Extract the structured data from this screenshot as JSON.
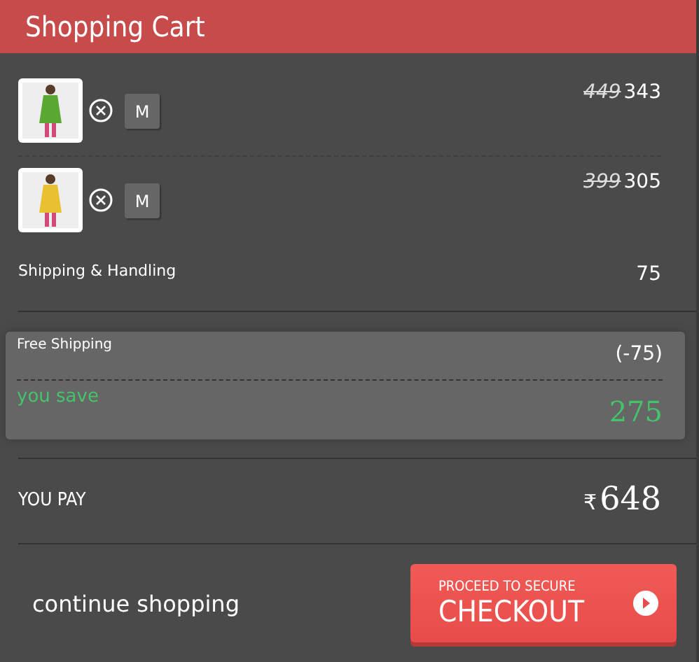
{
  "header": {
    "title": "Shopping Cart"
  },
  "items": [
    {
      "kind": "picture",
      "size": "M",
      "old_price": "449",
      "price": "343"
    },
    {
      "kind": "picture",
      "size": "M",
      "old_price": "399",
      "price": "305"
    }
  ],
  "shipping": {
    "label": "Shipping & Handling",
    "amount": "75"
  },
  "savings": {
    "free_shipping_label": "Free Shipping",
    "free_shipping_amount": "(-75)",
    "you_save_label": "you save",
    "you_save_amount": "275"
  },
  "total": {
    "label": "YOU PAY",
    "currency": "₹",
    "amount": "648"
  },
  "footer": {
    "continue_label": "continue shopping",
    "checkout_top": "PROCEED TO SECURE",
    "checkout_main": "CHECKOUT"
  }
}
